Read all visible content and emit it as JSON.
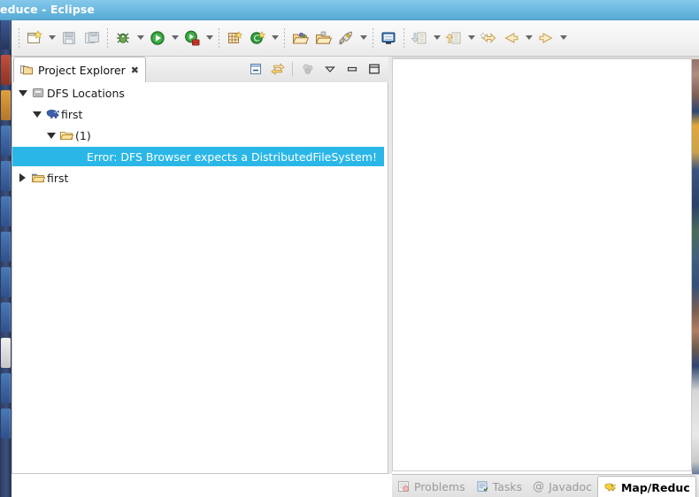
{
  "window": {
    "title": "educe - Eclipse",
    "title_full": "Map/Reduce - Eclipse",
    "titlebar_color": "#6fbbe2"
  },
  "toolbar": {
    "items": [
      {
        "name": "new-wizard-button",
        "icon": "new-file-icon",
        "enabled": true,
        "has_dropdown": true
      },
      {
        "name": "save-button",
        "icon": "save-disk-icon",
        "enabled": false,
        "has_dropdown": false
      },
      {
        "name": "save-all-button",
        "icon": "save-all-icon",
        "enabled": false,
        "has_dropdown": false
      },
      {
        "name": "debug-button",
        "icon": "debug-bug-icon",
        "enabled": true,
        "has_dropdown": true
      },
      {
        "name": "run-button",
        "icon": "run-play-icon",
        "enabled": true,
        "has_dropdown": true
      },
      {
        "name": "run-on-hadoop-button",
        "icon": "run-server-icon",
        "enabled": true,
        "has_dropdown": true
      },
      {
        "name": "new-java-package-button",
        "icon": "package-grid-icon",
        "enabled": true,
        "has_dropdown": false
      },
      {
        "name": "new-class-button",
        "icon": "new-class-icon",
        "enabled": true,
        "has_dropdown": true
      },
      {
        "name": "open-type-button",
        "icon": "open-folder-icon",
        "enabled": true,
        "has_dropdown": false
      },
      {
        "name": "open-task-button",
        "icon": "open-task-folder-icon",
        "enabled": true,
        "has_dropdown": false
      },
      {
        "name": "external-tools-button",
        "icon": "rocket-icon",
        "enabled": true,
        "has_dropdown": true
      },
      {
        "name": "console-button",
        "icon": "monitor-icon",
        "enabled": true,
        "has_dropdown": false
      },
      {
        "name": "previous-annotation-button",
        "icon": "annotation-down-icon",
        "enabled": false,
        "has_dropdown": true
      },
      {
        "name": "next-annotation-button",
        "icon": "annotation-up-icon",
        "enabled": false,
        "has_dropdown": true
      },
      {
        "name": "last-edit-location-button",
        "icon": "back-to-edit-icon",
        "enabled": true,
        "has_dropdown": false
      },
      {
        "name": "back-button",
        "icon": "arrow-left-icon",
        "enabled": true,
        "has_dropdown": true
      },
      {
        "name": "forward-button",
        "icon": "arrow-right-icon",
        "enabled": true,
        "has_dropdown": true
      }
    ]
  },
  "project_explorer": {
    "tab_label": "Project Explorer",
    "tab_close": "✖",
    "view_tools": [
      {
        "name": "collapse-all-button",
        "icon": "collapse-all-icon",
        "enabled": true
      },
      {
        "name": "link-with-editor-button",
        "icon": "link-editor-icon",
        "enabled": true
      },
      {
        "name": "focus-on-active-task-button",
        "icon": "focus-dots-icon",
        "enabled": false
      },
      {
        "name": "view-menu-button",
        "icon": "chevron-down-icon",
        "enabled": true
      },
      {
        "name": "minimize-view-button",
        "icon": "minimize-icon",
        "enabled": true
      },
      {
        "name": "maximize-view-button",
        "icon": "maximize-icon",
        "enabled": true
      }
    ],
    "tree": [
      {
        "label": "DFS Locations",
        "icon": "dfs-locations-icon",
        "indent": 0,
        "state": "expanded",
        "type": "node"
      },
      {
        "label": "first",
        "icon": "hadoop-elephant-icon",
        "indent": 1,
        "state": "expanded",
        "type": "node"
      },
      {
        "label": "(1)",
        "icon": "folder-icon",
        "indent": 2,
        "state": "expanded",
        "type": "node"
      },
      {
        "label": "Error: DFS Browser expects a DistributedFileSystem!",
        "icon": "none",
        "indent": 3,
        "state": "none",
        "type": "error",
        "selected": true
      },
      {
        "label": "first",
        "icon": "java-project-icon",
        "indent": 0,
        "state": "collapsed",
        "type": "node"
      }
    ],
    "selection_color": "#2ab7e8",
    "selection_text_color": "#ffffff"
  },
  "bottom_tabs": [
    {
      "label": "Problems",
      "icon": "problems-icon",
      "active": false
    },
    {
      "label": "Tasks",
      "icon": "tasks-icon",
      "active": false
    },
    {
      "label": "Javadoc",
      "icon": "javadoc-at-icon",
      "active": false
    },
    {
      "label": "Map/Reduc",
      "icon": "hadoop-elephant-yellow-icon",
      "active": true
    }
  ],
  "launcher": {
    "icons": [
      {
        "name": "launcher-icon-files",
        "color": "#2f4f8c"
      },
      {
        "name": "launcher-icon-firefox",
        "color": "#a8402f"
      },
      {
        "name": "launcher-icon-thunderbird",
        "color": "#c98b33"
      },
      {
        "name": "launcher-icon-writer",
        "color": "#3b6ca8"
      },
      {
        "name": "launcher-icon-calc",
        "color": "#3b6ca8"
      },
      {
        "name": "launcher-icon-impress",
        "color": "#3b6ca8"
      },
      {
        "name": "launcher-icon-software",
        "color": "#3b6ca8"
      },
      {
        "name": "launcher-icon-amazon",
        "color": "#3b6ca8"
      },
      {
        "name": "launcher-icon-terminal",
        "color": "#3b6ca8"
      },
      {
        "name": "launcher-icon-eclipse",
        "color": "#d8d8d8"
      },
      {
        "name": "launcher-icon-settings",
        "color": "#3b6ca8"
      },
      {
        "name": "launcher-icon-trash",
        "color": "#3b6ca8"
      }
    ]
  }
}
